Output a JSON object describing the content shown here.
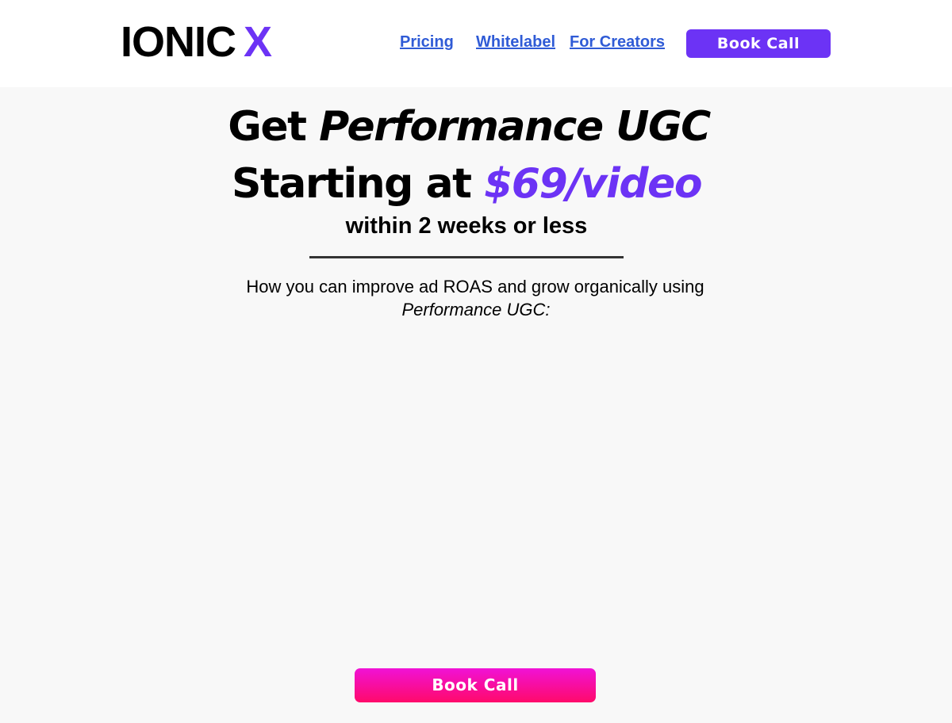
{
  "header": {
    "logo_text": "IONIC",
    "logo_accent": "X",
    "nav": {
      "pricing": "Pricing",
      "whitelabel": "Whitelabel",
      "creators": "For Creators"
    },
    "cta_label": "Book Call"
  },
  "hero": {
    "line1_plain": "Get",
    "line1_emphasis": "Performance UGC",
    "line2_plain": "Starting at",
    "line2_price": "$69/video",
    "subheadline": "within 2 weeks or less",
    "body_line1": "How you can improve ad ROAS and grow organically using",
    "body_line2": "Performance UGC:"
  },
  "footer_cta": {
    "label": "Book Call"
  },
  "colors": {
    "brand_purple": "#6c33f5",
    "link_blue": "#2f5bd6",
    "cta_gradient_top": "#f012d6",
    "cta_gradient_bottom": "#ff0a6a",
    "page_background": "#f8f8f8"
  }
}
